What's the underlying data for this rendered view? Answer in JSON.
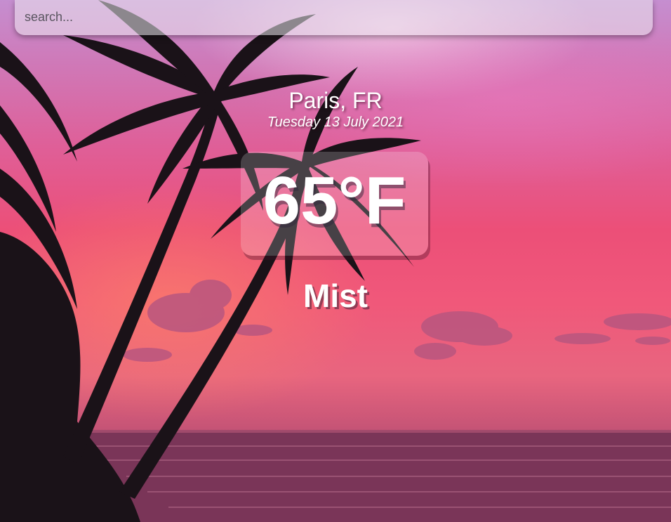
{
  "search": {
    "placeholder": "search...",
    "value": ""
  },
  "weather": {
    "location": "Paris, FR",
    "date": "Tuesday 13 July 2021",
    "temperature": "65°F",
    "conditions": "Mist"
  },
  "background": {
    "description_icon": "palm-sunset-background",
    "colors": {
      "sky_top": "#c58ed0",
      "sky_mid": "#ec4f78",
      "sea": "#6b2c4a",
      "silhouette": "#1a1218"
    }
  }
}
